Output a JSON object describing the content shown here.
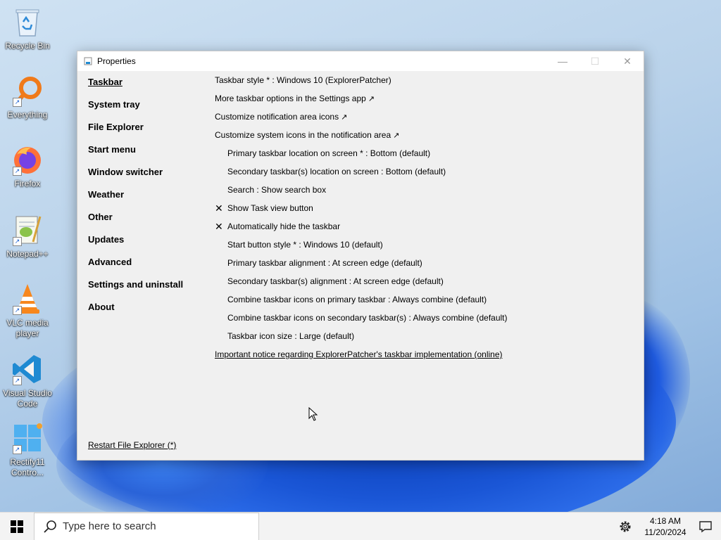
{
  "desktop": {
    "icons": [
      {
        "label": "Recycle Bin",
        "icon": "recycle-bin-icon"
      },
      {
        "label": "Everything",
        "icon": "everything-icon"
      },
      {
        "label": "Firefox",
        "icon": "firefox-icon"
      },
      {
        "label": "Notepad++",
        "icon": "notepad-plus-plus-icon"
      },
      {
        "label": "VLC media player",
        "icon": "vlc-icon"
      },
      {
        "label": "Visual Studio Code",
        "icon": "vscode-icon"
      },
      {
        "label": "Rectify11 Contro...",
        "icon": "rectify11-icon"
      }
    ]
  },
  "window": {
    "title": "Properties",
    "sidebar": [
      {
        "label": "Taskbar",
        "active": true
      },
      {
        "label": "System tray"
      },
      {
        "label": "File Explorer"
      },
      {
        "label": "Start menu"
      },
      {
        "label": "Window switcher"
      },
      {
        "label": "Weather"
      },
      {
        "label": "Other"
      },
      {
        "label": "Updates"
      },
      {
        "label": "Advanced"
      },
      {
        "label": "Settings and uninstall"
      },
      {
        "label": "About"
      }
    ],
    "options": [
      {
        "text": "Taskbar style * : Windows 10 (ExplorerPatcher)"
      },
      {
        "text": "More taskbar options in the Settings app",
        "external": "↗"
      },
      {
        "text": "Customize notification area icons",
        "external": "↗"
      },
      {
        "text": "Customize system icons in the notification area",
        "external": "↗"
      },
      {
        "text": "Primary taskbar location on screen * : Bottom (default)"
      },
      {
        "text": "Secondary taskbar(s) location on screen : Bottom (default)"
      },
      {
        "text": "Search : Show search box"
      },
      {
        "text": "Show Task view button",
        "checked": "✕"
      },
      {
        "text": "Automatically hide the taskbar",
        "checked": "✕"
      },
      {
        "text": "Start button style * : Windows 10 (default)"
      },
      {
        "text": "Primary taskbar alignment : At screen edge (default)"
      },
      {
        "text": "Secondary taskbar(s) alignment : At screen edge (default)"
      },
      {
        "text": "Combine taskbar icons on primary taskbar : Always combine (default)"
      },
      {
        "text": "Combine taskbar icons on secondary taskbar(s) : Always combine (default)"
      },
      {
        "text": "Taskbar icon size : Large (default)"
      },
      {
        "text": "Important notice regarding ExplorerPatcher's taskbar implementation (online)"
      }
    ],
    "restart_label": "Restart File Explorer (*)"
  },
  "taskbar": {
    "search_placeholder": "Type here to search",
    "time": "4:18 AM",
    "date": "11/20/2024"
  }
}
